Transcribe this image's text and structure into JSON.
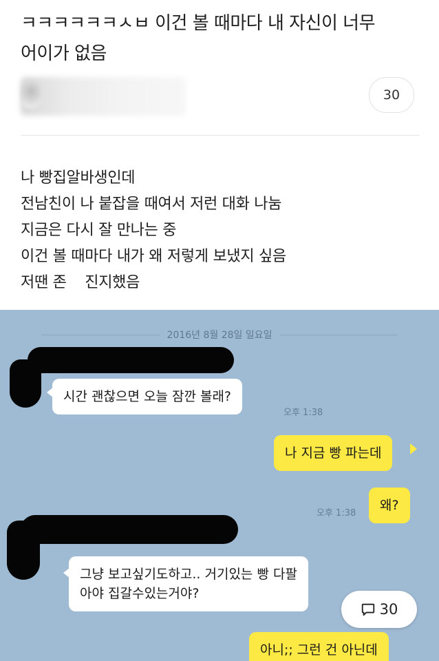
{
  "post": {
    "title_line1": "ㅋㅋㅋㅋㅋㅋㅅㅂ 이건 볼 때마다 내 자신이 너무",
    "title_line2": "어이가 없음",
    "comment_count": "30",
    "body": [
      "나 빵집알바생인데",
      "전남친이 나 붙잡을 때여서 저런 대화 나눔",
      "지금은 다시 잘 만나는 중",
      "이건 볼 때마다 내가 왜 저렇게 보냈지 싶음",
      "저땐 존    진지했음"
    ]
  },
  "chat": {
    "date": "2016년 8월 28일 일요일",
    "messages": [
      {
        "side": "left",
        "text": "시간 괜찮으면 오늘 잠깐 볼래?",
        "time": "오후 1:38"
      },
      {
        "side": "right",
        "text": "나 지금 빵 파는데",
        "time": ""
      },
      {
        "side": "right",
        "text": "왜?",
        "time": "오후 1:38"
      },
      {
        "side": "left",
        "text": "그냥 보고싶기도하고.. 거기있는 빵 다팔\n아야 집갈수있는거야?",
        "time": ""
      },
      {
        "side": "right",
        "text": "아니;; 그런 건 아닌데",
        "time": ""
      }
    ]
  },
  "floating_comment": {
    "icon": "speech-bubble-icon",
    "count": "30"
  },
  "colors": {
    "chat_bg": "#9fbad3",
    "my_bubble": "#fde944",
    "their_bubble": "#ffffff"
  }
}
